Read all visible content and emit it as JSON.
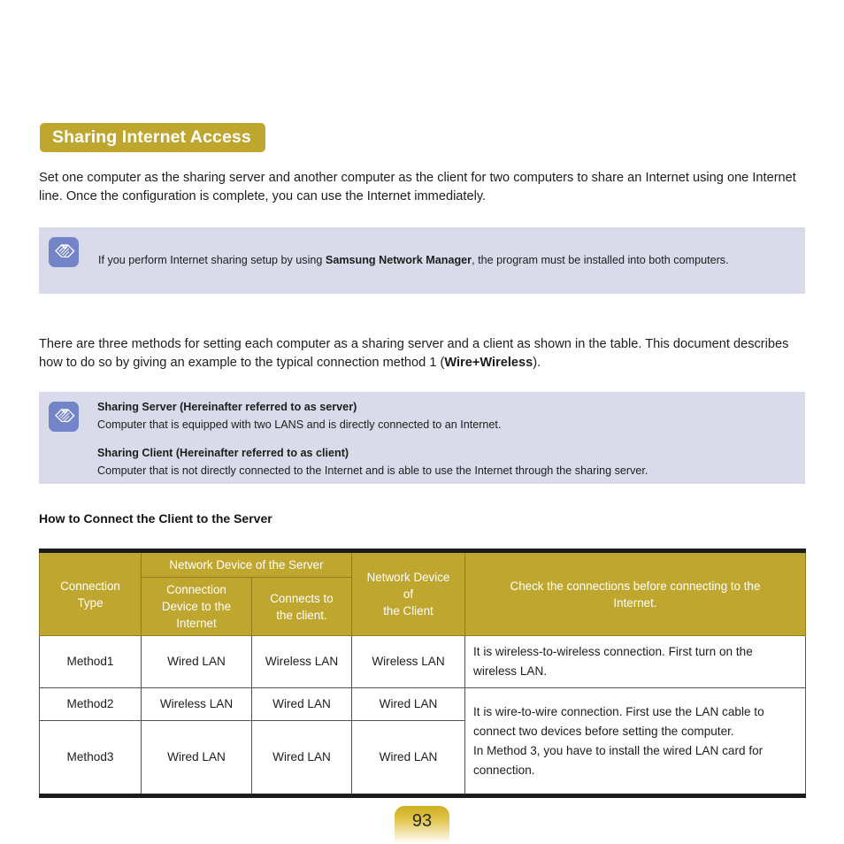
{
  "section": {
    "title": "Sharing Internet Access"
  },
  "intro_paragraph": "Set one computer as the sharing server and another computer as the client for two computers to share an Internet using one Internet line. Once the configuration is complete, you can use the Internet immediately.",
  "note_1": {
    "icon": "pencil-note-icon",
    "text_before": "If you perform Internet sharing setup by using ",
    "emphasis": "Samsung Network Manager",
    "text_after": ", the program must be installed into both computers."
  },
  "methods_paragraph": {
    "text_before": "There are three methods for setting each computer as a sharing server and a client as shown in the table. This document describes how to do so by giving an example to the typical connection method 1 (",
    "emphasis": "Wire+Wireless",
    "text_after": ")."
  },
  "note_2": {
    "icon": "pencil-note-icon",
    "server_heading": "Sharing Server (Hereinafter referred to as server)",
    "server_text": "Computer that is equipped with two LANS and is directly connected to an Internet.",
    "client_heading": "Sharing Client (Hereinafter referred to as client)",
    "client_text": "Computer that is not directly connected to the Internet and is able to use the Internet through the sharing server."
  },
  "subheading": "How to Connect the Client to the Server",
  "table": {
    "headers": {
      "connection_type": "Connection\nType",
      "server_group": "Network Device of the Server",
      "server_device_internet": "Connection\nDevice to the\nInternet",
      "server_connects_client": "Connects to\nthe client.",
      "client_device": "Network Device\nof\nthe Client",
      "check": "Check the connections before connecting to the\nInternet."
    },
    "rows": [
      {
        "type": "Method1",
        "server_internet": "Wired LAN",
        "server_client": "Wireless LAN",
        "client": "Wireless LAN",
        "description": "It is wireless-to-wireless connection. First turn on the wireless LAN."
      },
      {
        "type": "Method2",
        "server_internet": "Wireless LAN",
        "server_client": "Wired LAN",
        "client": "Wired LAN",
        "description": "It is wire-to-wire connection. First use the LAN cable to connect two devices before setting the computer.\nIn Method 3, you have to install the wired LAN card for connection."
      },
      {
        "type": "Method3",
        "server_internet": "Wired LAN",
        "server_client": "Wired LAN",
        "client": "Wired LAN",
        "description": ""
      }
    ]
  },
  "page_number": "93",
  "colors": {
    "gold": "#bfa62e",
    "note_bg": "#d9dbea",
    "note_icon_bg": "#7384c8",
    "rule_dark": "#1c1c1c"
  }
}
